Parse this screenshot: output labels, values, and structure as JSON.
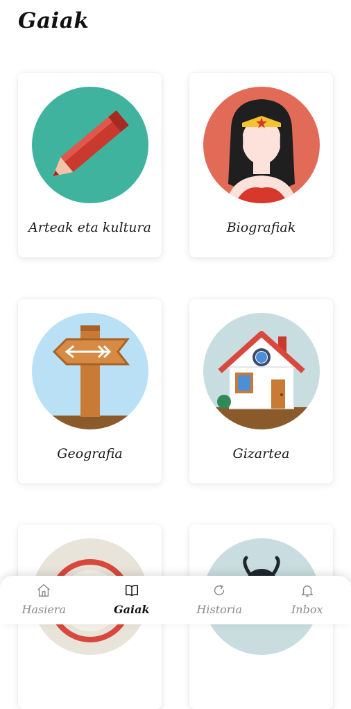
{
  "header": {
    "title": "Gaiak"
  },
  "subjects": [
    {
      "label": "Arteak eta kultura",
      "icon": "pencil-icon",
      "bg": "#3fb39e"
    },
    {
      "label": "Biografiak",
      "icon": "wonder-woman-icon",
      "bg": "#e26b58"
    },
    {
      "label": "Geografia",
      "icon": "signpost-icon",
      "bg": "#b9e0f5"
    },
    {
      "label": "Gizartea",
      "icon": "house-icon",
      "bg": "#c8dde0"
    },
    {
      "label": "",
      "icon": "target-icon",
      "bg": "#e8e4da"
    },
    {
      "label": "",
      "icon": "insect-icon",
      "bg": "#c9dde0"
    }
  ],
  "nav": {
    "items": [
      {
        "label": "Hasiera",
        "icon": "home-icon"
      },
      {
        "label": "Gaiak",
        "icon": "book-icon",
        "active": true
      },
      {
        "label": "Historia",
        "icon": "history-icon"
      },
      {
        "label": "Inbox",
        "icon": "bell-icon"
      }
    ]
  }
}
